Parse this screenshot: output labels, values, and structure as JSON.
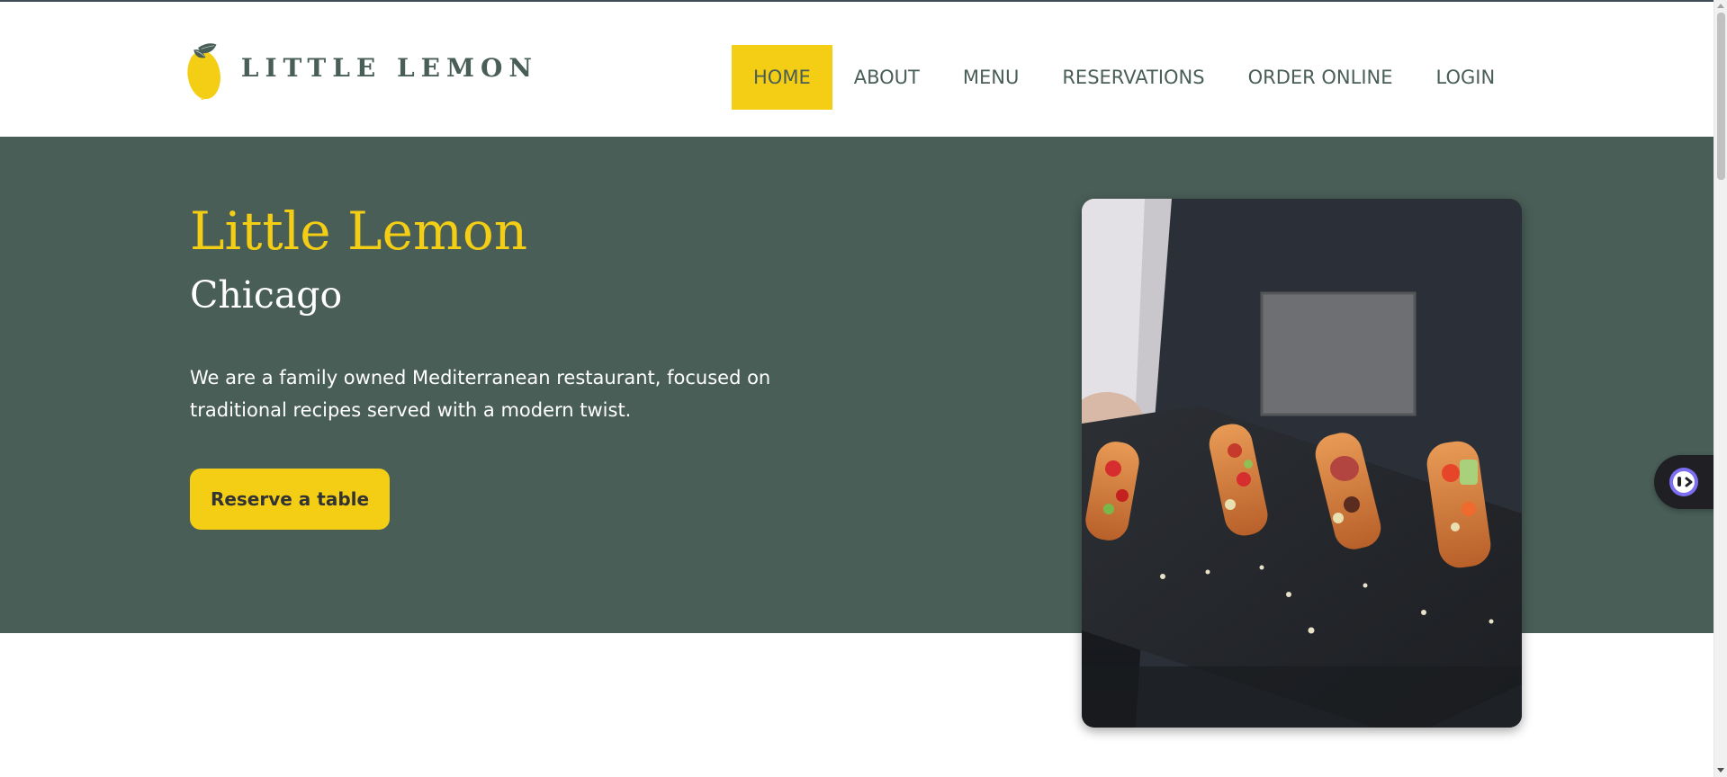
{
  "brand": {
    "name": "LITTLE LEMON",
    "logo_icon": "lemon-icon",
    "colors": {
      "primary_green": "#495e57",
      "primary_yellow": "#f4ce14",
      "white": "#ffffff"
    }
  },
  "nav": {
    "items": [
      {
        "label": "HOME",
        "active": true
      },
      {
        "label": "ABOUT",
        "active": false
      },
      {
        "label": "MENU",
        "active": false
      },
      {
        "label": "RESERVATIONS",
        "active": false
      },
      {
        "label": "ORDER ONLINE",
        "active": false
      },
      {
        "label": "LOGIN",
        "active": false
      }
    ]
  },
  "hero": {
    "title": "Little Lemon",
    "subtitle": "Chicago",
    "description": "We are a family owned Mediterranean restaurant, focused on traditional recipes served with a modern twist.",
    "cta_label": "Reserve a table",
    "image_icon": "food-photo"
  },
  "widget": {
    "icon": "assistant-face-icon"
  }
}
